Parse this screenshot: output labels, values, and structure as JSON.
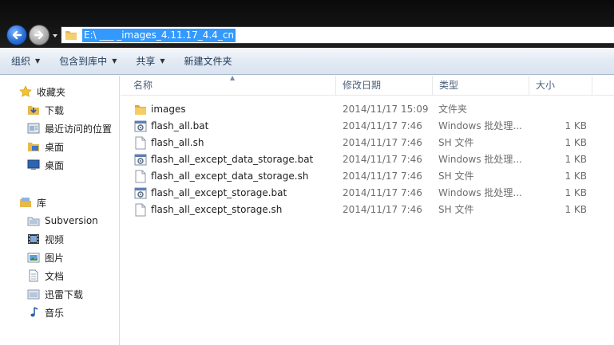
{
  "address": {
    "path": "E:\\ ___ _images_4.11.17_4.4_cn"
  },
  "toolbar": {
    "organize": "组织",
    "include_in_library": "包含到库中",
    "share": "共享",
    "new_folder": "新建文件夹"
  },
  "sidebar": {
    "favorites": "收藏夹",
    "downloads": "下载",
    "recent": "最近访问的位置",
    "desktop1": "桌面",
    "desktop2": "桌面",
    "libraries": "库",
    "subversion": "Subversion",
    "videos": "视频",
    "pictures": "图片",
    "documents": "文档",
    "thunder": "迅雷下载",
    "music": "音乐"
  },
  "columns": {
    "name": "名称",
    "date": "修改日期",
    "type": "类型",
    "size": "大小"
  },
  "files": [
    {
      "name": "images",
      "date": "2014/11/17 15:09",
      "type": "文件夹",
      "size": "",
      "icon": "folder-icon"
    },
    {
      "name": "flash_all.bat",
      "date": "2014/11/17 7:46",
      "type": "Windows 批处理...",
      "size": "1 KB",
      "icon": "batch-file-icon"
    },
    {
      "name": "flash_all.sh",
      "date": "2014/11/17 7:46",
      "type": "SH 文件",
      "size": "1 KB",
      "icon": "file-icon"
    },
    {
      "name": "flash_all_except_data_storage.bat",
      "date": "2014/11/17 7:46",
      "type": "Windows 批处理...",
      "size": "1 KB",
      "icon": "batch-file-icon"
    },
    {
      "name": "flash_all_except_data_storage.sh",
      "date": "2014/11/17 7:46",
      "type": "SH 文件",
      "size": "1 KB",
      "icon": "file-icon"
    },
    {
      "name": "flash_all_except_storage.bat",
      "date": "2014/11/17 7:46",
      "type": "Windows 批处理...",
      "size": "1 KB",
      "icon": "batch-file-icon"
    },
    {
      "name": "flash_all_except_storage.sh",
      "date": "2014/11/17 7:46",
      "type": "SH 文件",
      "size": "1 KB",
      "icon": "file-icon"
    }
  ]
}
